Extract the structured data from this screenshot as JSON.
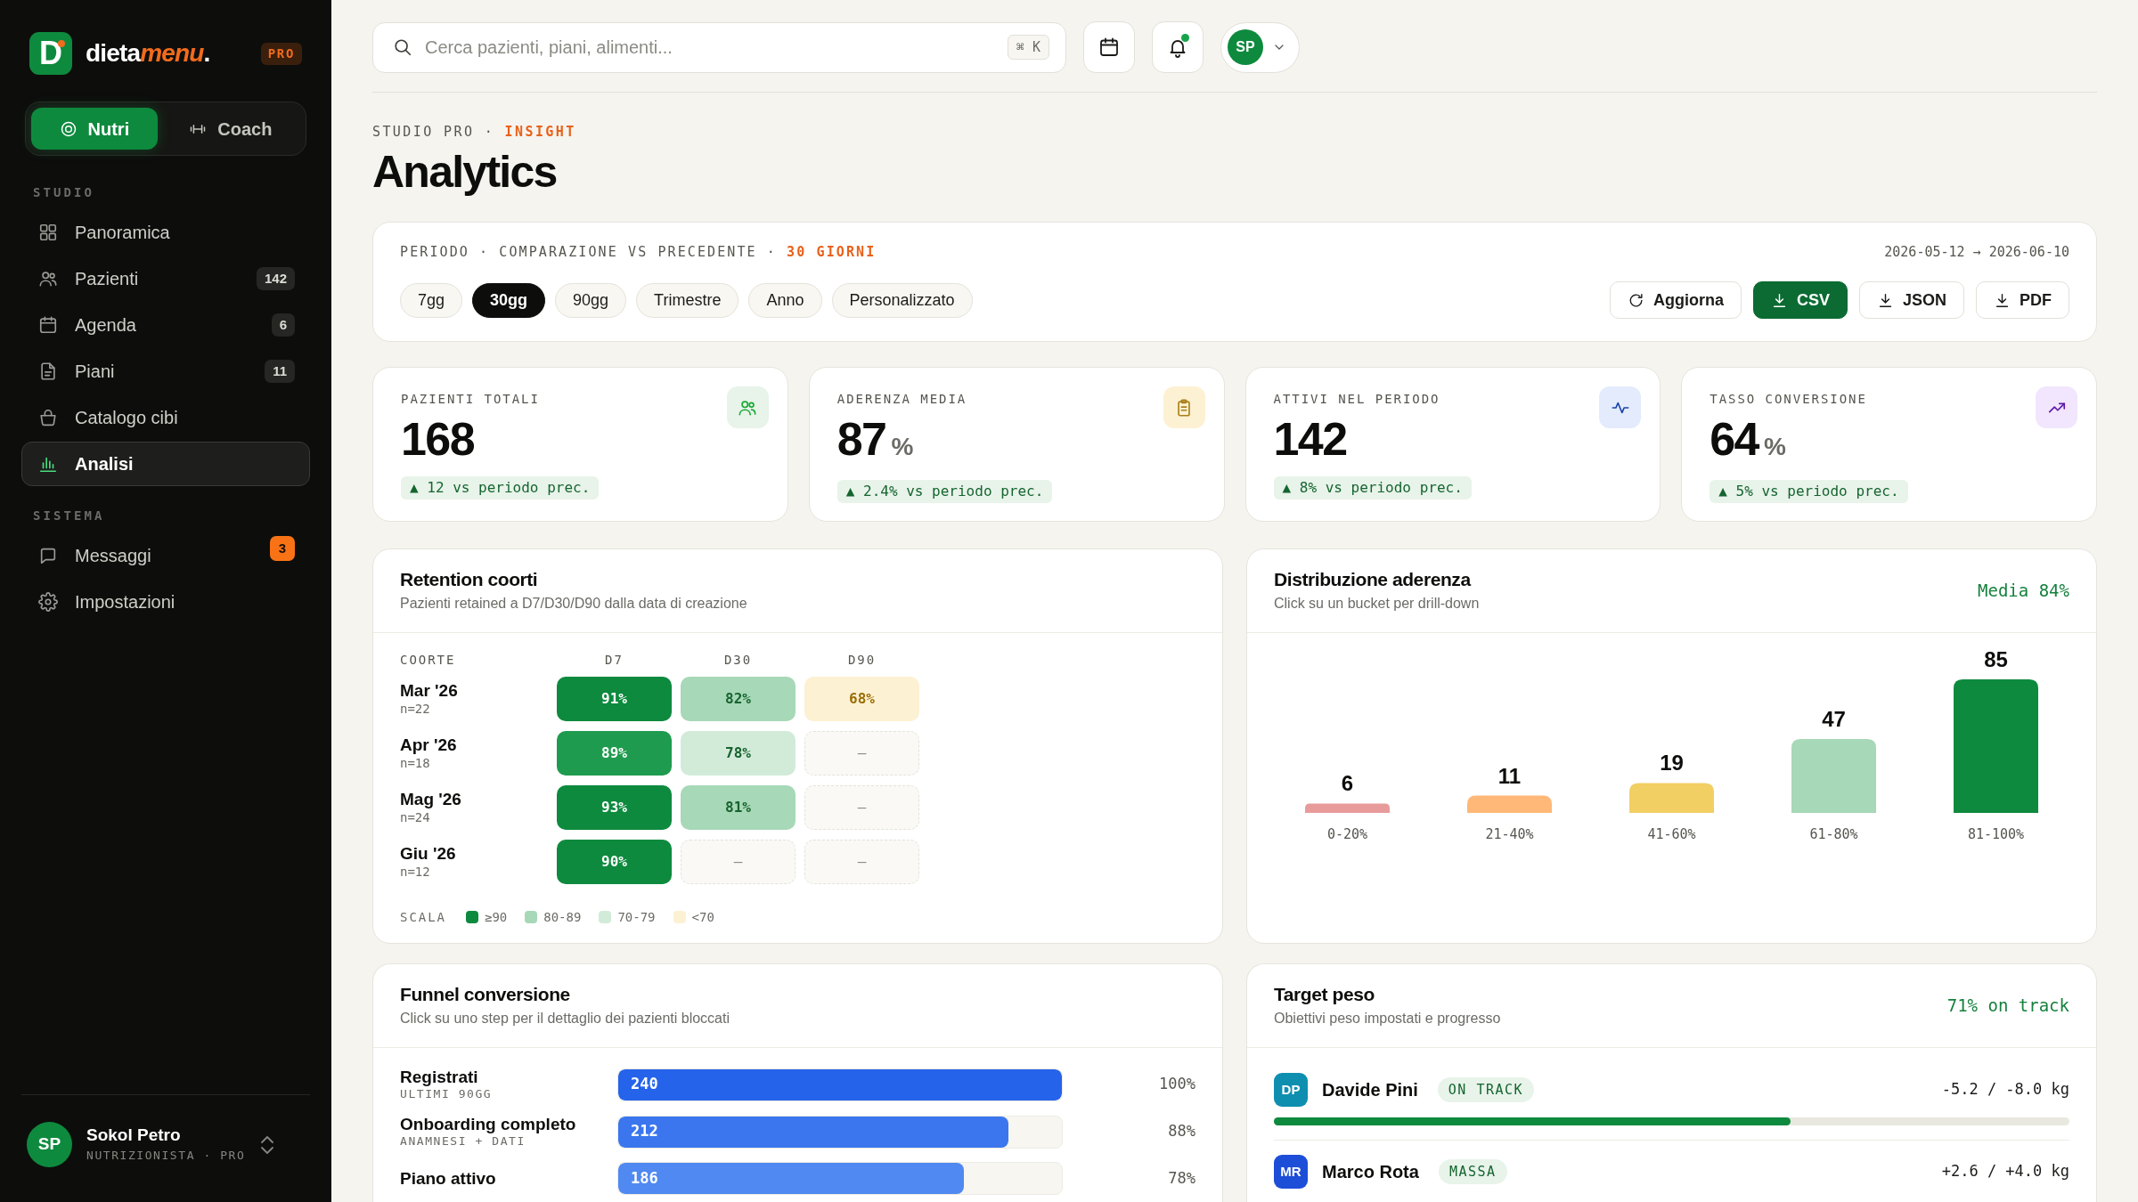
{
  "sidebar": {
    "brand": {
      "mark": "D",
      "name": "dieta",
      "accent": "menu",
      "suffix": ".",
      "badge": "PRO"
    },
    "modes": [
      {
        "label": "Nutri",
        "selected": true
      },
      {
        "label": "Coach",
        "selected": false
      }
    ],
    "sections": [
      {
        "title": "STUDIO",
        "items": [
          {
            "label": "Panoramica",
            "selected": false
          },
          {
            "label": "Pazienti",
            "badge": "142",
            "badge_alert": false,
            "selected": false
          },
          {
            "label": "Agenda",
            "badge": "6",
            "badge_alert": false,
            "selected": false
          },
          {
            "label": "Piani",
            "badge": "11",
            "badge_alert": false,
            "selected": false
          },
          {
            "label": "Catalogo cibi",
            "selected": false
          },
          {
            "label": "Analisi",
            "selected": true
          }
        ]
      },
      {
        "title": "SISTEMA",
        "items": [
          {
            "label": "Messaggi",
            "badge": "3",
            "badge_alert": true,
            "selected": false
          },
          {
            "label": "Impostazioni",
            "selected": false
          }
        ]
      }
    ],
    "user": {
      "initials": "SP",
      "name": "Sokol Petro",
      "role": "NUTRIZIONISTA · PRO"
    }
  },
  "header": {
    "search": {
      "placeholder": "Cerca pazienti, piani, alimenti...",
      "shortcut": "⌘ K"
    },
    "notifications": {
      "unread": true
    },
    "user": {
      "initials": "SP"
    }
  },
  "page": {
    "eyebrow": "STUDIO PRO · **INSIGHT**",
    "title": "Analytics"
  },
  "period": {
    "label": "PERIODO · COMPARAZIONE VS PRECEDENTE · **30 GIORNI**",
    "range": "2026-05-12 → 2026-06-10",
    "options": [
      {
        "label": "7gg",
        "selected": false
      },
      {
        "label": "30gg",
        "selected": true
      },
      {
        "label": "90gg",
        "selected": false
      },
      {
        "label": "Trimestre",
        "selected": false
      },
      {
        "label": "Anno",
        "selected": false
      },
      {
        "label": "Personalizzato",
        "selected": false
      }
    ],
    "actions": [
      {
        "label": "Aggiorna",
        "kind": "refresh",
        "primary": false
      },
      {
        "label": "CSV",
        "kind": "export",
        "primary": true
      },
      {
        "label": "JSON",
        "kind": "export",
        "primary": false
      },
      {
        "label": "PDF",
        "kind": "export",
        "primary": false
      }
    ]
  },
  "kpis": [
    {
      "label": "PAZIENTI TOTALI",
      "value": "168",
      "delta": "▲ 12 vs periodo prec.",
      "color": "#e8f3ea"
    },
    {
      "label": "ADERENZA MEDIA",
      "value": "87",
      "unit": "%",
      "delta": "▲ 2.4% vs periodo prec.",
      "color": "#fdf1d3"
    },
    {
      "label": "ATTIVI NEL PERIODO",
      "value": "142",
      "delta": "▲ 8% vs periodo prec.",
      "color": "#e3ebfd"
    },
    {
      "label": "TASSO CONVERSIONE",
      "value": "64",
      "unit": "%",
      "delta": "▲ 5% vs periodo prec.",
      "color": "#f1e6fd"
    }
  ],
  "retention": {
    "title": "Retention coorti",
    "subtitle": "Pazienti retained a D7/D30/D90 dalla data di creazione",
    "cohort_header": "COORTE",
    "columns": [
      "D7",
      "D30",
      "D90"
    ],
    "rows": [
      {
        "cohort": "Mar '26",
        "size": "n=22",
        "cells": [
          {
            "text": "91%",
            "kind": "filled",
            "color": "#0e8a3e"
          },
          {
            "text": "82%",
            "kind": "filled",
            "color": "#a7d8b7"
          },
          {
            "text": "68%",
            "kind": "filled",
            "color": "#fdf1d3"
          }
        ]
      },
      {
        "cohort": "Apr '26",
        "size": "n=18",
        "cells": [
          {
            "text": "89%",
            "kind": "filled",
            "color": "#1f9b4f"
          },
          {
            "text": "78%",
            "kind": "filled",
            "color": "#d2ebd9"
          },
          {
            "text": "–",
            "kind": "empty"
          }
        ]
      },
      {
        "cohort": "Mag '26",
        "size": "n=24",
        "cells": [
          {
            "text": "93%",
            "kind": "filled",
            "color": "#0e8a3e"
          },
          {
            "text": "81%",
            "kind": "filled",
            "color": "#a7d8b7"
          },
          {
            "text": "–",
            "kind": "empty"
          }
        ]
      },
      {
        "cohort": "Giu '26",
        "size": "n=12",
        "cells": [
          {
            "text": "90%",
            "kind": "filled",
            "color": "#0e8a3e"
          },
          {
            "text": "–",
            "kind": "empty"
          },
          {
            "text": "–",
            "kind": "empty"
          }
        ]
      }
    ],
    "legend": {
      "title": "SCALA",
      "items": [
        {
          "label": "≥90",
          "color": "#0e8a3e"
        },
        {
          "label": "80-89",
          "color": "#a7d8b7"
        },
        {
          "label": "70-79",
          "color": "#d2ebd9"
        },
        {
          "label": "<70",
          "color": "#fdf1d3"
        }
      ]
    }
  },
  "distribution": {
    "title": "Distribuzione aderenza",
    "subtitle": "Click su un bucket per drill-down",
    "summary": "Media 84%",
    "buckets": [
      {
        "color": "#e89b9b"
      },
      {
        "color": "#ffb877"
      },
      {
        "color": "#f2cf63"
      },
      {
        "color": "#a7d8b7"
      },
      {
        "color": "#0e8a3e"
      }
    ],
    "chart_data": {
      "type": "bar",
      "categories": [
        "0-20%",
        "21-40%",
        "41-60%",
        "61-80%",
        "81-100%"
      ],
      "values": [
        6,
        11,
        19,
        47,
        85
      ],
      "data_labels": true
    }
  },
  "funnel": {
    "title": "Funnel conversione",
    "subtitle": "Click su uno step per il dettaglio dei pazienti bloccati",
    "steps": [
      {
        "label": "Registrati",
        "caption": "ULTIMI 90GG",
        "count": "240",
        "share": "100%",
        "level": 1,
        "color": "#2563eb"
      },
      {
        "label": "Onboarding completo",
        "caption": "ANAMNESI + DATI",
        "count": "212",
        "share": "88%",
        "level": 0.88,
        "color": "#3b76ee"
      },
      {
        "label": "Piano attivo",
        "count": "186",
        "share": "78%",
        "level": 0.78,
        "color": "#5089f1"
      }
    ]
  },
  "targets": {
    "title": "Target peso",
    "subtitle": "Obiettivi peso impostati e progresso",
    "summary": "71% on track",
    "patients": [
      {
        "initials": "DP",
        "name": "Davide Pini",
        "tag": "ON TRACK",
        "change": "-5.2 / -8.0 kg",
        "level": 0.65,
        "color": "#0e8fb0"
      },
      {
        "initials": "MR",
        "name": "Marco Rota",
        "tag": "MASSA",
        "change": "+2.6 / +4.0 kg",
        "color": "#1d4ed8"
      }
    ]
  }
}
